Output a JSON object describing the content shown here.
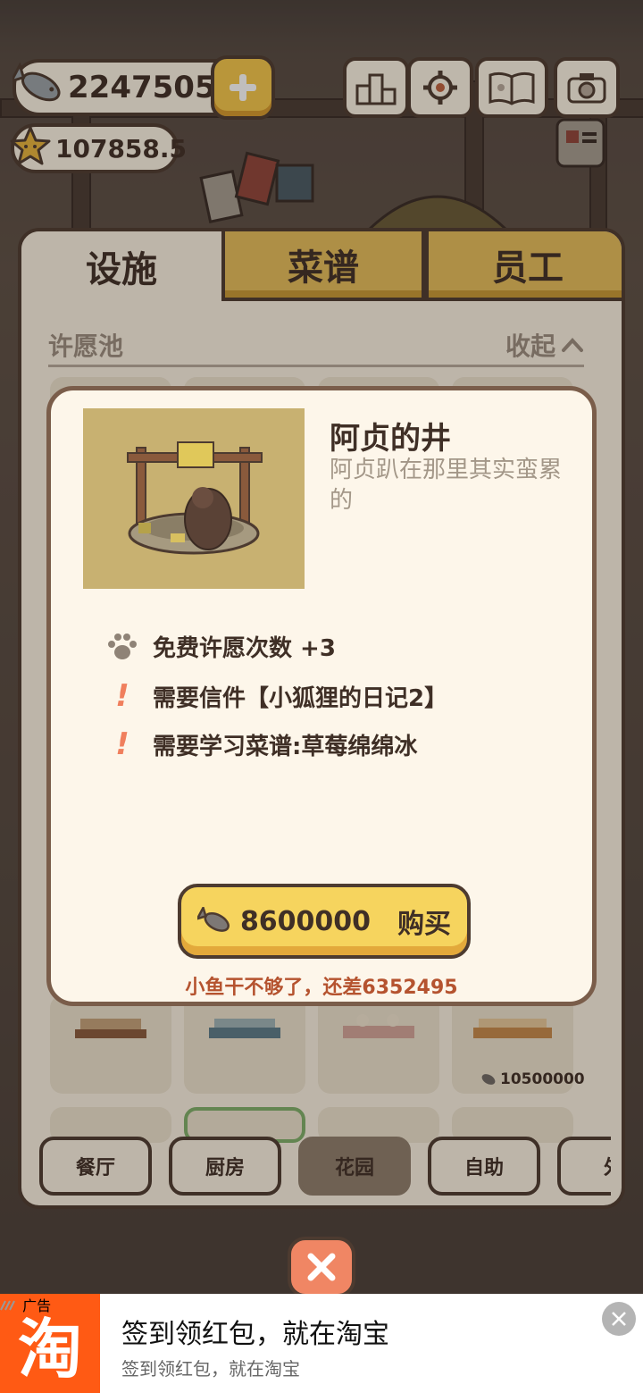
{
  "hud": {
    "fish_amount": "2247505",
    "star_amount": "107858.5"
  },
  "tabs": [
    {
      "label": "设施",
      "active": true
    },
    {
      "label": "菜谱",
      "active": false
    },
    {
      "label": "员工",
      "active": false
    }
  ],
  "section": {
    "title": "许愿池",
    "collapse_label": "收起"
  },
  "grid": {
    "price_label": "10500000"
  },
  "categories": [
    {
      "label": "餐厅",
      "active": false
    },
    {
      "label": "厨房",
      "active": false
    },
    {
      "label": "花园",
      "active": true
    },
    {
      "label": "自助",
      "active": false
    },
    {
      "label": "外",
      "active": false
    }
  ],
  "item": {
    "name": "阿贞的井",
    "description": "阿贞趴在那里其实蛮累的",
    "effects": [
      {
        "icon": "paw-icon",
        "text": "免费许愿次数 +3"
      },
      {
        "icon": "exclamation-icon",
        "text": "需要信件【小狐狸的日记2】"
      },
      {
        "icon": "exclamation-icon",
        "text": "需要学习菜谱:草莓绵绵冰"
      }
    ],
    "price": "8600000",
    "buy_label": "购买",
    "warning": "小鱼干不够了，还差6352495"
  },
  "ad": {
    "title": "签到领红包，就在淘宝",
    "subtitle": "签到领红包，就在淘宝",
    "logo_char": "淘",
    "label": "广告"
  },
  "colors": {
    "panel_bg": "#fbf3e4",
    "tab_inactive": "#e6be5a",
    "button_yellow": "#f6d45e",
    "warning_text": "#b5532f",
    "ad_orange": "#ff5a14"
  }
}
